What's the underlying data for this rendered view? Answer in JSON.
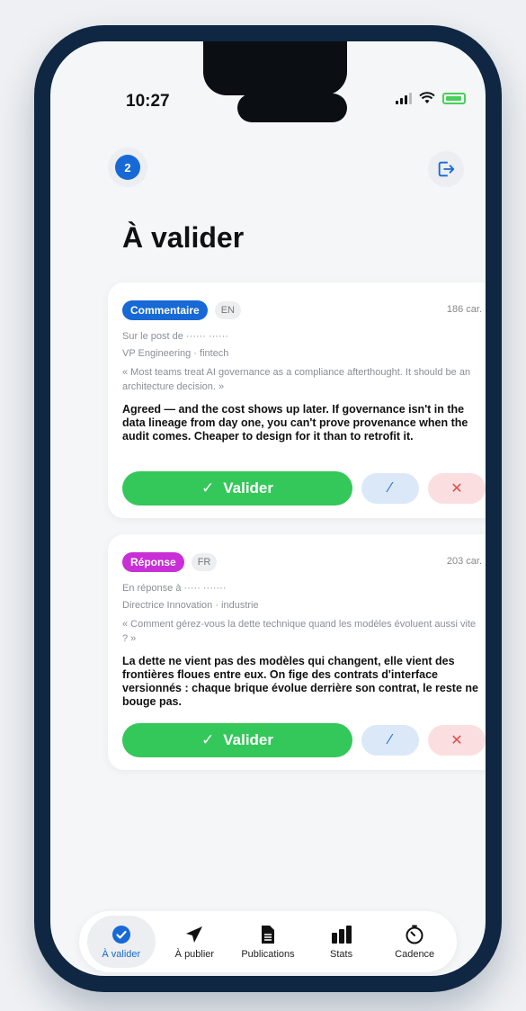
{
  "status": {
    "time": "10:27"
  },
  "header": {
    "pending_count": "2",
    "title": "À valider"
  },
  "cards": [
    {
      "type": "Commentaire",
      "type_color": "#1769d6",
      "lang": "EN",
      "chars": "186 car.",
      "context_line1": "Sur le post de ······ ······",
      "context_line2": "VP Engineering · fintech",
      "quote": "« Most teams treat AI governance as a compliance afterthought. It should be an architecture decision. »",
      "body": "Agreed — and the cost shows up later. If governance isn't in the data lineage from day one, you can't prove provenance when the audit comes. Cheaper to design for it than to retrofit it.",
      "validate_label": "Valider"
    },
    {
      "type": "Réponse",
      "type_color": "#c92fd6",
      "lang": "FR",
      "chars": "203 car.",
      "context_line1": "En réponse à ····· ·······",
      "context_line2": "Directrice Innovation · industrie",
      "quote": "« Comment gérez-vous la dette technique quand les modèles évoluent aussi vite ? »",
      "body": "La dette ne vient pas des modèles qui changent, elle vient des frontières floues entre eux. On fige des contrats d'interface versionnés : chaque brique évolue derrière son contrat, le reste ne bouge pas.",
      "validate_label": "Valider"
    }
  ],
  "tabbar": {
    "items": [
      {
        "label": "À valider",
        "icon": "check-circle-icon"
      },
      {
        "label": "À publier",
        "icon": "send-icon"
      },
      {
        "label": "Publications",
        "icon": "document-icon"
      },
      {
        "label": "Stats",
        "icon": "bar-chart-icon"
      },
      {
        "label": "Cadence",
        "icon": "timer-icon"
      }
    ]
  },
  "colors": {
    "accent": "#1769d6",
    "validate": "#34c759",
    "reject": "#e5484d",
    "frame": "#0f2742"
  }
}
